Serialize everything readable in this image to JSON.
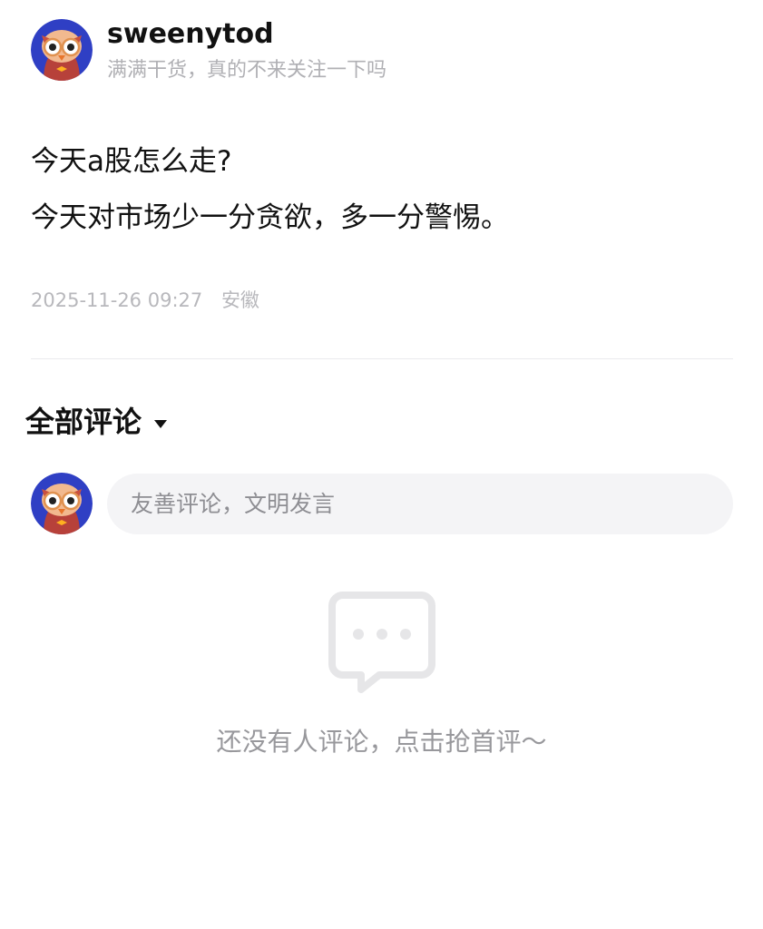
{
  "author": {
    "name": "sweenytod",
    "bio": "满满干货，真的不来关注一下吗",
    "avatar_icon": "owl-mascot-avatar-icon"
  },
  "post": {
    "title": "今天a股怎么走?",
    "body": "今天对市场少一分贪欲，多一分警惕。",
    "datetime": "2025-11-26 09:27",
    "location": "安徽"
  },
  "comments": {
    "header": "全部评论",
    "input_placeholder": "友善评论，文明发言",
    "empty_icon": "chat-bubble-dots-icon",
    "empty_text": "还没有人评论，点击抢首评～"
  },
  "colors": {
    "text_primary": "#111111",
    "text_secondary": "#b0b0b4",
    "input_bg": "#f4f4f6",
    "empty_icon": "#e6e6e8",
    "avatar_bg": "#2f3fc4"
  }
}
